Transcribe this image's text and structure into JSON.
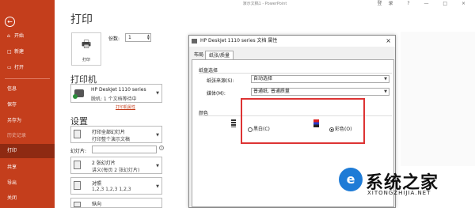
{
  "window": {
    "title": "演示文稿1 - PowerPoint",
    "right": "登录 ? — □ ×"
  },
  "sidebar": {
    "back_icon": "back-arrow-icon",
    "items": [
      {
        "label": "开始",
        "icon": "⌂"
      },
      {
        "label": "新建",
        "icon": "□"
      },
      {
        "label": "打开",
        "icon": "▭"
      },
      {
        "label": "信息"
      },
      {
        "label": "保存"
      },
      {
        "label": "另存为"
      },
      {
        "label": "历史记录"
      },
      {
        "label": "打印"
      },
      {
        "label": "共享"
      },
      {
        "label": "导出"
      },
      {
        "label": "关闭"
      }
    ],
    "active": "打印"
  },
  "print": {
    "heading": "打印",
    "button_label": "打印",
    "copies_label": "份数:",
    "copies_value": "1"
  },
  "printer": {
    "heading": "打印机",
    "name": "HP DeskJet 1110 series",
    "status": "脱机: 1 个文档等待中",
    "properties_link": "打印机属性"
  },
  "settings": {
    "heading": "设置",
    "slides_range": {
      "line1": "打印全部幻灯片",
      "line2": "打印整个演示文稿"
    },
    "slides_label": "幻灯片:",
    "layout": {
      "line1": "2 张幻灯片",
      "line2": "讲义(每页 2 张幻灯片)"
    },
    "collate": {
      "line1": "对照",
      "line2": "1,2,3    1,2,3    1,2,3"
    },
    "orientation": {
      "line1": "纵向"
    }
  },
  "dialog": {
    "title": "HP DeskJet 1110 series 文档 属性",
    "tabs": [
      "布局",
      "纸张/质量"
    ],
    "selected_tab": "纸张/质量",
    "tray_group": "纸盘选择",
    "paper_source_label": "纸张来源(S):",
    "paper_source_value": "自动选择",
    "media_label": "媒体(M):",
    "media_value": "普通纸, 普通质量",
    "color_group": "颜色",
    "bw_label": "黑白(C)",
    "color_label": "彩色(O)",
    "selected_color": "彩色(O)"
  },
  "watermark": {
    "logo": "e",
    "big": "系统之家",
    "small": "XITONGZHIJIA.NET"
  },
  "colors": {
    "accent": "#c43e1c",
    "highlight": "#d33333"
  }
}
